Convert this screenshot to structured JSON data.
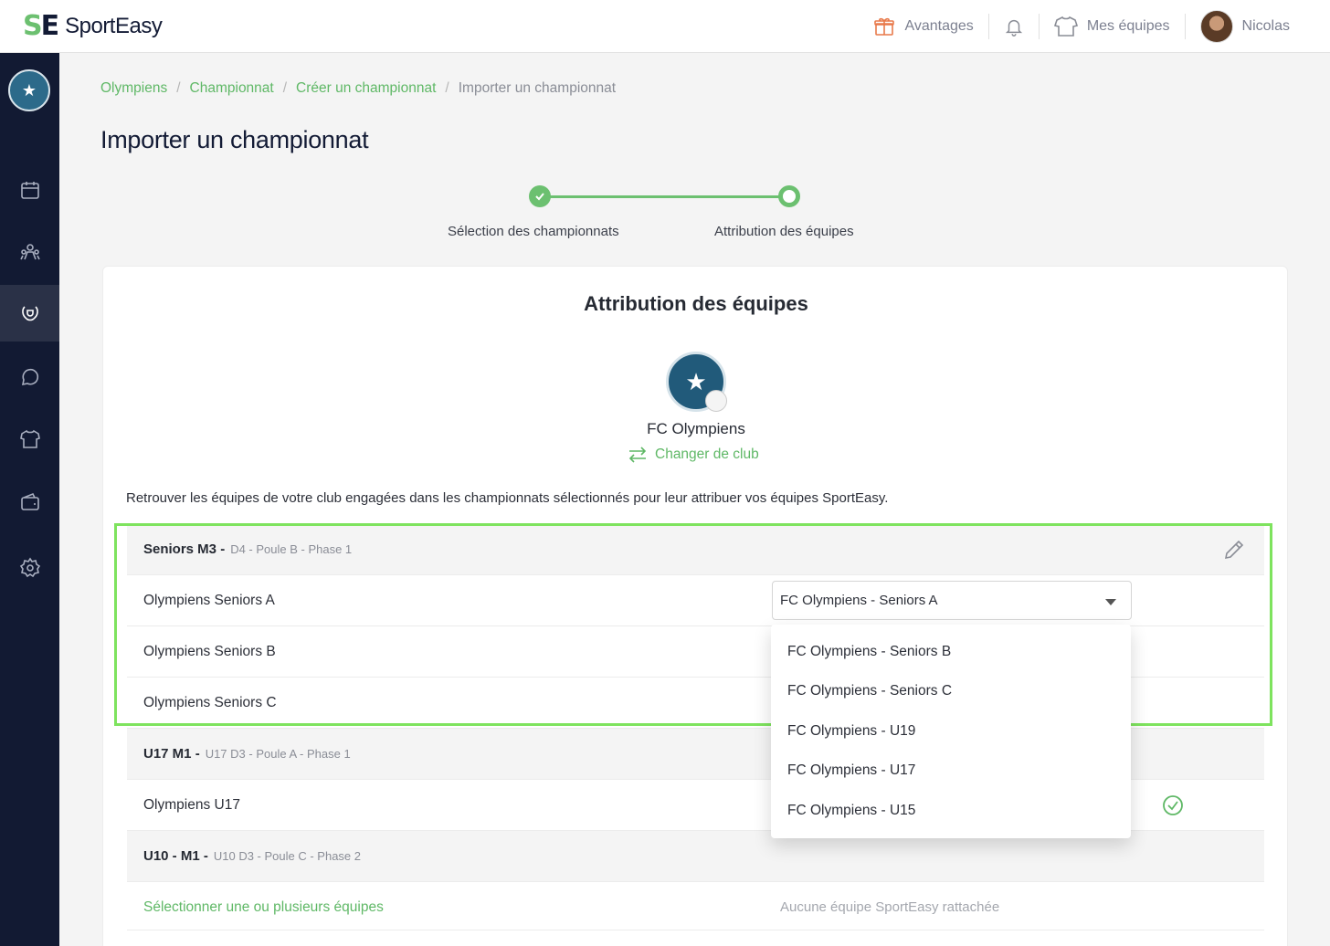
{
  "brand": {
    "name": "SportEasy",
    "accent": "#6cc070",
    "navy": "#121a33"
  },
  "topnav": {
    "perks_label": "Avantages",
    "teams_label": "Mes équipes",
    "user_name": "Nicolas"
  },
  "breadcrumb": {
    "items": [
      "Olympiens",
      "Championnat",
      "Créer un championnat"
    ],
    "current": "Importer un championnat",
    "separator": "/"
  },
  "page": {
    "title": "Importer un championnat"
  },
  "stepper": {
    "steps": [
      {
        "label": "Sélection des championnats",
        "status": "done"
      },
      {
        "label": "Attribution des équipes",
        "status": "current"
      }
    ]
  },
  "card": {
    "title": "Attribution des équipes",
    "club_name": "FC Olympiens",
    "change_club_label": "Changer de club",
    "intro": "Retrouver les équipes de votre club engagées dans les championnats sélectionnés pour leur attribuer vos équipes SportEasy."
  },
  "groups": [
    {
      "name": "Seniors M3 -",
      "meta": "D4 - Poule B - Phase 1",
      "teams": [
        {
          "name": "Olympiens Seniors A",
          "selected": "FC Olympiens - Seniors A"
        },
        {
          "name": "Olympiens Seniors B"
        },
        {
          "name": "Olympiens Seniors C"
        }
      ]
    },
    {
      "name": "U17 M1 -",
      "meta": "U17 D3 - Poule A - Phase 1",
      "teams": [
        {
          "name": "Olympiens U17"
        }
      ]
    },
    {
      "name": "U10 - M1 -",
      "meta": "U10 D3 - Poule C - Phase 2",
      "teams": [
        {
          "name": "Sélectionner une ou plusieurs équipes",
          "status": "Aucune équipe SportEasy rattachée"
        }
      ]
    }
  ],
  "dropdown": {
    "options": [
      "FC Olympiens - Seniors B",
      "FC Olympiens - Seniors C",
      "FC Olympiens - U19",
      "FC Olympiens - U17",
      "FC Olympiens - U15"
    ]
  },
  "icons": {
    "sidebar": [
      "calendar-icon",
      "team-icon",
      "trophy-icon",
      "chat-icon",
      "shirt-icon",
      "wallet-icon",
      "settings-icon"
    ]
  }
}
